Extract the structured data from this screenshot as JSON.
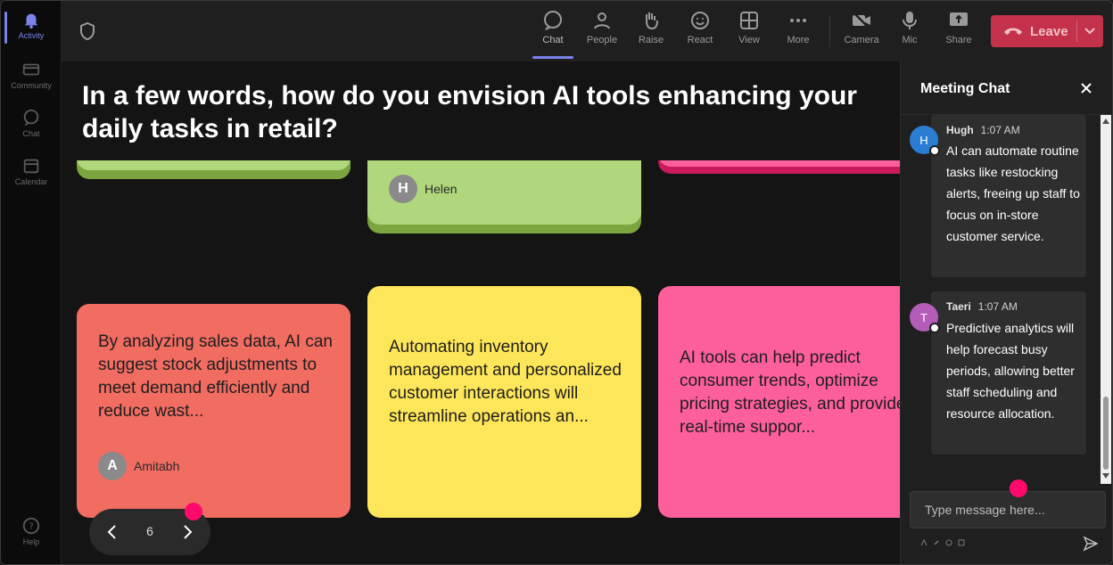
{
  "rail": [
    {
      "label": "Activity",
      "icon": "bell-icon",
      "active": true
    },
    {
      "label": "Community",
      "icon": "community-icon",
      "active": false
    },
    {
      "label": "Chat",
      "icon": "chat-icon",
      "active": false
    },
    {
      "label": "Calendar",
      "icon": "calendar-icon",
      "active": false
    },
    {
      "label": "Help",
      "icon": "help-icon",
      "active": false
    }
  ],
  "toolbar": {
    "buttons": [
      {
        "label": "Chat",
        "icon": "chat-icon",
        "active": true
      },
      {
        "label": "People",
        "icon": "people-icon"
      },
      {
        "label": "Raise",
        "icon": "raise-hand-icon"
      },
      {
        "label": "React",
        "icon": "react-icon"
      },
      {
        "label": "View",
        "icon": "view-icon"
      },
      {
        "label": "More",
        "icon": "more-icon"
      },
      {
        "label": "Camera",
        "icon": "camera-off-icon"
      },
      {
        "label": "Mic",
        "icon": "mic-icon"
      },
      {
        "label": "Share",
        "icon": "share-icon"
      }
    ],
    "leave_label": "Leave",
    "leave_color": "#c4314b"
  },
  "question": "In a few words, how do you envision AI tools enhancing your daily tasks in retail?",
  "notes": [
    {
      "text": "",
      "author": "Helen",
      "initial": "H",
      "color": "#b1d77d"
    },
    {
      "text": "By analyzing sales data, AI can suggest stock adjustments to meet demand efficiently and reduce wast...",
      "author": "Amitabh",
      "initial": "A",
      "color": "#f16c61"
    },
    {
      "text": "Automating inventory management and personalized customer interactions will streamline operations an...",
      "author": "",
      "initial": "",
      "color": "#fde659"
    },
    {
      "text": "AI tools can help predict consumer trends, optimize pricing strategies, and provide real-time suppor...",
      "author": "",
      "initial": "",
      "color": "#fd5e9c"
    }
  ],
  "pager": {
    "page": "6"
  },
  "chat": {
    "title": "Meeting Chat",
    "messages": [
      {
        "name": "Hugh",
        "time": "1:07 AM",
        "initial": "H",
        "avatar_color": "#2b7cd3",
        "text": "AI can automate routine tasks like restocking alerts, freeing up staff to focus on in-store customer service."
      },
      {
        "name": "Taeri",
        "time": "1:07 AM",
        "initial": "T",
        "avatar_color": "#b55bb8",
        "text": "Predictive analytics will help forecast busy periods, allowing better staff scheduling and resource allocation."
      }
    ],
    "input_placeholder": "Type message here..."
  },
  "accent_color": "#7b83eb",
  "indicator_color": "#ff0a6c"
}
